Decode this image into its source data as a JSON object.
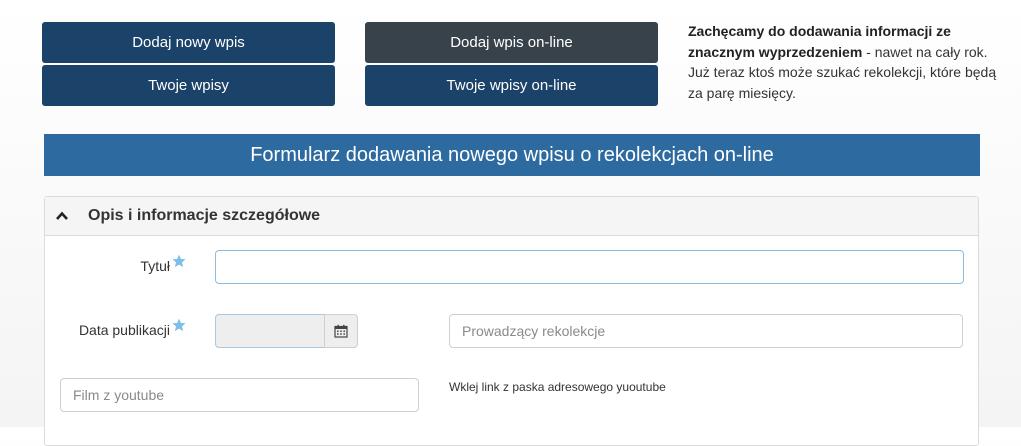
{
  "buttons": {
    "add_new": "Dodaj nowy wpis",
    "my_entries": "Twoje wpisy",
    "add_online": "Dodaj wpis on-line",
    "my_entries_online": "Twoje wpisy on-line"
  },
  "info": {
    "bold_text": "Zachęcamy do dodawania informacji ze znacznym wyprzedzeniem",
    "rest_text": " - nawet na cały rok. Już teraz ktoś może szukać rekolekcji, które będą za parę miesięcy."
  },
  "form": {
    "banner_title": "Formularz dodawania nowego wpisu o rekolekcjach on-line",
    "section_title": "Opis i informacje szczegółowe",
    "fields": {
      "title_label": "Tytuł",
      "title_value": "",
      "date_label": "Data publikacji",
      "date_value": "",
      "leader_placeholder": "Prowadzący rekolekcje",
      "youtube_placeholder": "Film z youtube",
      "youtube_hint": "Wklej link z paska adresowego yuoutube"
    }
  },
  "icons": {
    "chevron": "chevron-up-icon",
    "required": "star-icon",
    "calendar": "calendar-icon"
  },
  "colors": {
    "navy_button": "#1b4268",
    "dark_button": "#37424a",
    "banner": "#2d6a9f",
    "required_star": "#7fbfe6"
  }
}
